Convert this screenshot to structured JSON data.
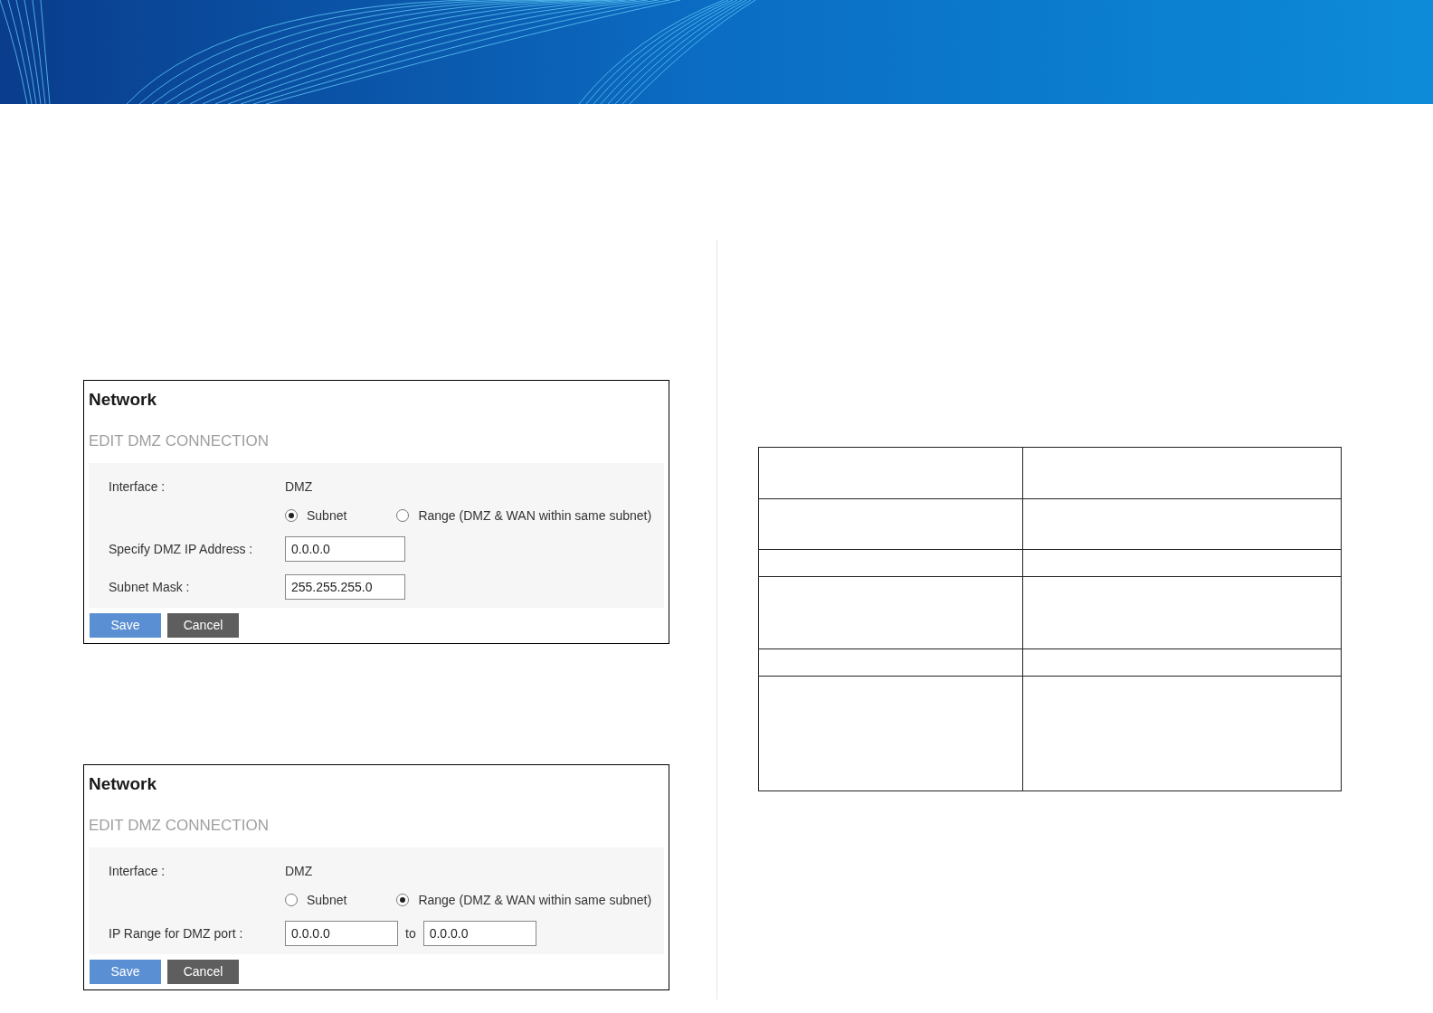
{
  "panels": [
    {
      "title": "Network",
      "subtitle": "EDIT DMZ CONNECTION",
      "interface_label": "Interface :",
      "interface_value": "DMZ",
      "options": [
        {
          "label": "Subnet",
          "selected": true
        },
        {
          "label": "Range (DMZ & WAN within same subnet)",
          "selected": false
        }
      ],
      "fields": [
        {
          "label": "Specify DMZ IP Address :",
          "inputs": [
            "0.0.0.0"
          ]
        },
        {
          "label": "Subnet Mask :",
          "inputs": [
            "255.255.255.0"
          ]
        }
      ],
      "buttons": [
        {
          "kind": "primary",
          "label": "Save"
        },
        {
          "kind": "secondary",
          "label": "Cancel"
        }
      ]
    },
    {
      "title": "Network",
      "subtitle": "EDIT DMZ CONNECTION",
      "interface_label": "Interface :",
      "interface_value": "DMZ",
      "options": [
        {
          "label": "Subnet",
          "selected": false
        },
        {
          "label": "Range (DMZ & WAN within same subnet)",
          "selected": true
        }
      ],
      "fields": [
        {
          "label": "IP Range for DMZ port :",
          "inputs": [
            "0.0.0.0",
            "0.0.0.0"
          ],
          "joiner": "to"
        }
      ],
      "buttons": [
        {
          "kind": "primary",
          "label": "Save"
        },
        {
          "kind": "secondary",
          "label": "Cancel"
        }
      ]
    }
  ]
}
